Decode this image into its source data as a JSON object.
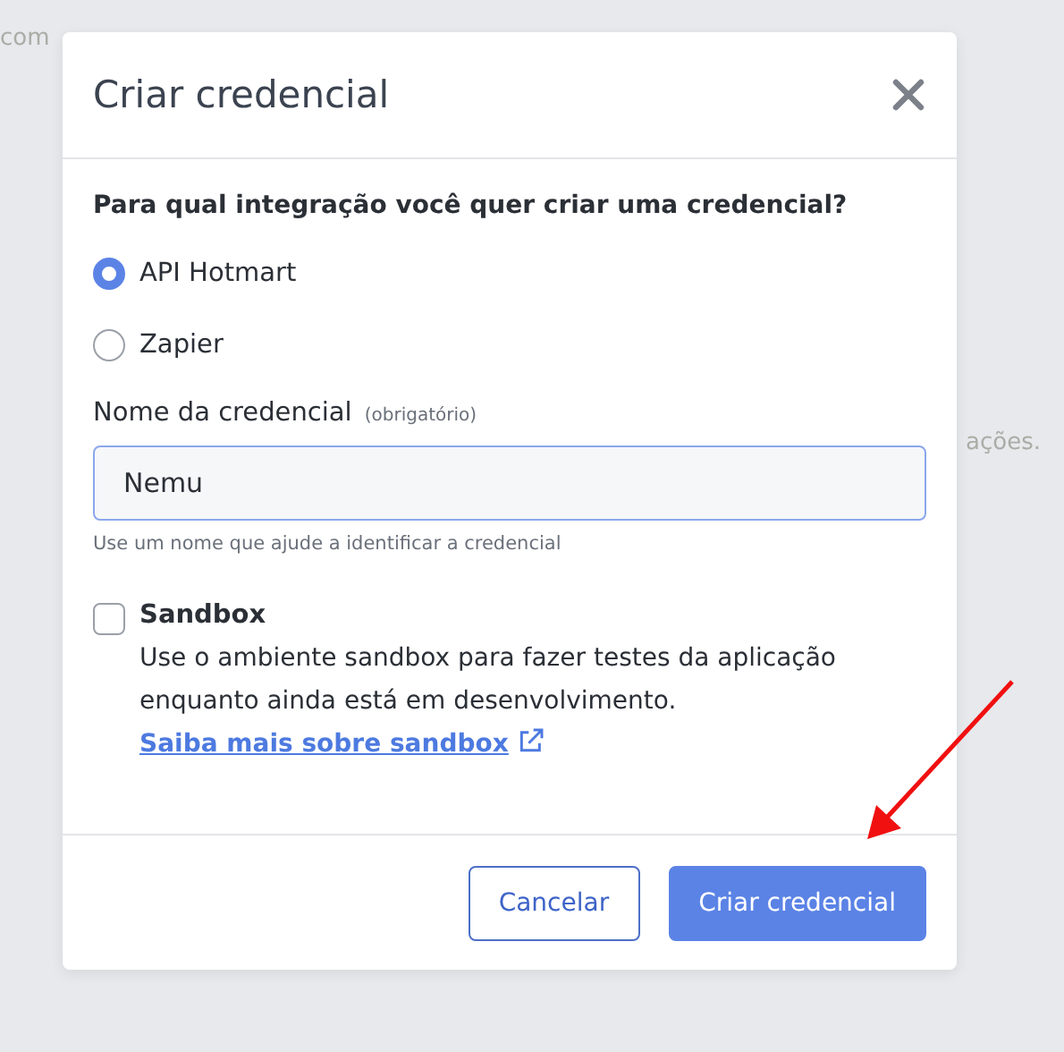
{
  "background_texts": [
    "com",
    "ações."
  ],
  "dialog": {
    "title": "Criar credencial",
    "question": "Para qual integração você quer criar uma credencial?",
    "integrations": [
      {
        "label": "API Hotmart",
        "selected": true
      },
      {
        "label": "Zapier",
        "selected": false
      }
    ],
    "name_field": {
      "label": "Nome da credencial",
      "required_note": "(obrigatório)",
      "value": "Nemu",
      "help": "Use um nome que ajude a identificar a credencial"
    },
    "sandbox": {
      "label": "Sandbox",
      "checked": false,
      "description": "Use o ambiente sandbox para fazer testes da aplicação enquanto ainda está em desenvolvimento.",
      "link": "Saiba mais sobre sandbox"
    },
    "buttons": [
      {
        "label": "Cancelar",
        "kind": "secondary"
      },
      {
        "label": "Criar credencial",
        "kind": "primary"
      }
    ]
  }
}
